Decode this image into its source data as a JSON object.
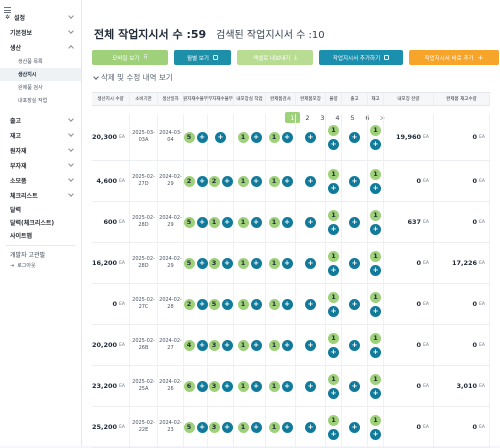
{
  "sidebar": {
    "items": [
      {
        "label": "설정",
        "expanded": false
      },
      {
        "label": "기본정보",
        "expanded": false
      },
      {
        "label": "생산",
        "expanded": true
      }
    ],
    "sub_items": [
      "생산품 목록",
      "생산지시",
      "완제품 검사",
      "내포장실 작업"
    ],
    "active_sub": "생산지시",
    "more_items": [
      "출고",
      "재고",
      "원자재",
      "부자재",
      "소모품",
      "체크리스트"
    ],
    "plain_items": [
      "달력",
      "달력(체크리스트)",
      "사이트맵"
    ],
    "user_name": "개발자 고관필",
    "logout_label": "로그아웃"
  },
  "header": {
    "total_label": "전체 작업지시서 수 :59",
    "search_label": "검색된 작업지시서 수 :10"
  },
  "toolbar": {
    "mobile_view": "모바일 보기",
    "monthly_view": "월별 보기",
    "excel_export": "엑셀로 내보내기",
    "add_order": "작업지시서 추가하기",
    "quick_add": "작업지시서 바로 추가"
  },
  "history_label": "삭제 및 수정 내역 보기",
  "pagination": {
    "pages": [
      "1",
      "2",
      "3",
      "4",
      "5",
      "6"
    ],
    "current": "1",
    "next": ">"
  },
  "table": {
    "columns": [
      "생산지시 수량",
      "소비기한",
      "생산일자",
      "원자재수불부",
      "부자재수불부",
      "내포장실 작업",
      "완제품검사",
      "완제품포장",
      "불량",
      "출고",
      "재고",
      "내포장 잔량",
      "완제품 재고수량"
    ],
    "unit": "EA",
    "rows": [
      {
        "qty": "20,300",
        "expiry": [
          "2025-03-",
          "03A"
        ],
        "prod": [
          "2024-03-",
          "04"
        ],
        "raw": "5",
        "sub": "",
        "inner": "1",
        "qc": "1",
        "pack": "",
        "defect": "1",
        "out": "",
        "stock": "1",
        "inner_rem": "19,960",
        "fin": "0"
      },
      {
        "qty": "4,600",
        "expiry": [
          "2025-02-",
          "27D"
        ],
        "prod": [
          "2024-02-",
          "29"
        ],
        "raw": "2",
        "sub": "2",
        "inner": "1",
        "qc": "1",
        "pack": "",
        "defect": "1",
        "out": "",
        "stock": "1",
        "inner_rem": "0",
        "fin": "0"
      },
      {
        "qty": "600",
        "expiry": [
          "2025-02-",
          "28D"
        ],
        "prod": [
          "2024-02-",
          "29"
        ],
        "raw": "5",
        "sub": "1",
        "inner": "1",
        "qc": "1",
        "pack": "",
        "defect": "1",
        "out": "",
        "stock": "1",
        "inner_rem": "637",
        "fin": "0"
      },
      {
        "qty": "16,200",
        "expiry": [
          "2025-02-",
          "28D"
        ],
        "prod": [
          "2024-02-",
          "29"
        ],
        "raw": "5",
        "sub": "3",
        "inner": "1",
        "qc": "1",
        "pack": "",
        "defect": "1",
        "out": "",
        "stock": "1",
        "inner_rem": "0",
        "fin": "17,226"
      },
      {
        "qty": "0",
        "expiry": [
          "2025-02-",
          "27C"
        ],
        "prod": [
          "2024-02-",
          "28"
        ],
        "raw": "2",
        "sub": "5",
        "inner": "1",
        "qc": "1",
        "pack": "",
        "defect": "1",
        "out": "",
        "stock": "1",
        "inner_rem": "0",
        "fin": "0"
      },
      {
        "qty": "20,200",
        "expiry": [
          "2025-02-",
          "26B"
        ],
        "prod": [
          "2024-02-",
          "27"
        ],
        "raw": "4",
        "sub": "3",
        "inner": "1",
        "qc": "1",
        "pack": "",
        "defect": "1",
        "out": "",
        "stock": "1",
        "inner_rem": "0",
        "fin": "0"
      },
      {
        "qty": "23,200",
        "expiry": [
          "2025-02-",
          "25A"
        ],
        "prod": [
          "2024-02-",
          "26"
        ],
        "raw": "6",
        "sub": "3",
        "inner": "1",
        "qc": "1",
        "pack": "",
        "defect": "1",
        "out": "",
        "stock": "1",
        "inner_rem": "0",
        "fin": "3,010"
      },
      {
        "qty": "25,200",
        "expiry": [
          "2025-02-",
          "22E"
        ],
        "prod": [
          "2024-02-",
          "23"
        ],
        "raw": "5",
        "sub": "3",
        "inner": "1",
        "qc": "1",
        "pack": "",
        "defect": "1",
        "out": "",
        "stock": "1",
        "inner_rem": "0",
        "fin": "0"
      }
    ]
  },
  "colors": {
    "green": "#9fd07a",
    "teal": "#117a9b",
    "orange": "#f6a42a"
  }
}
